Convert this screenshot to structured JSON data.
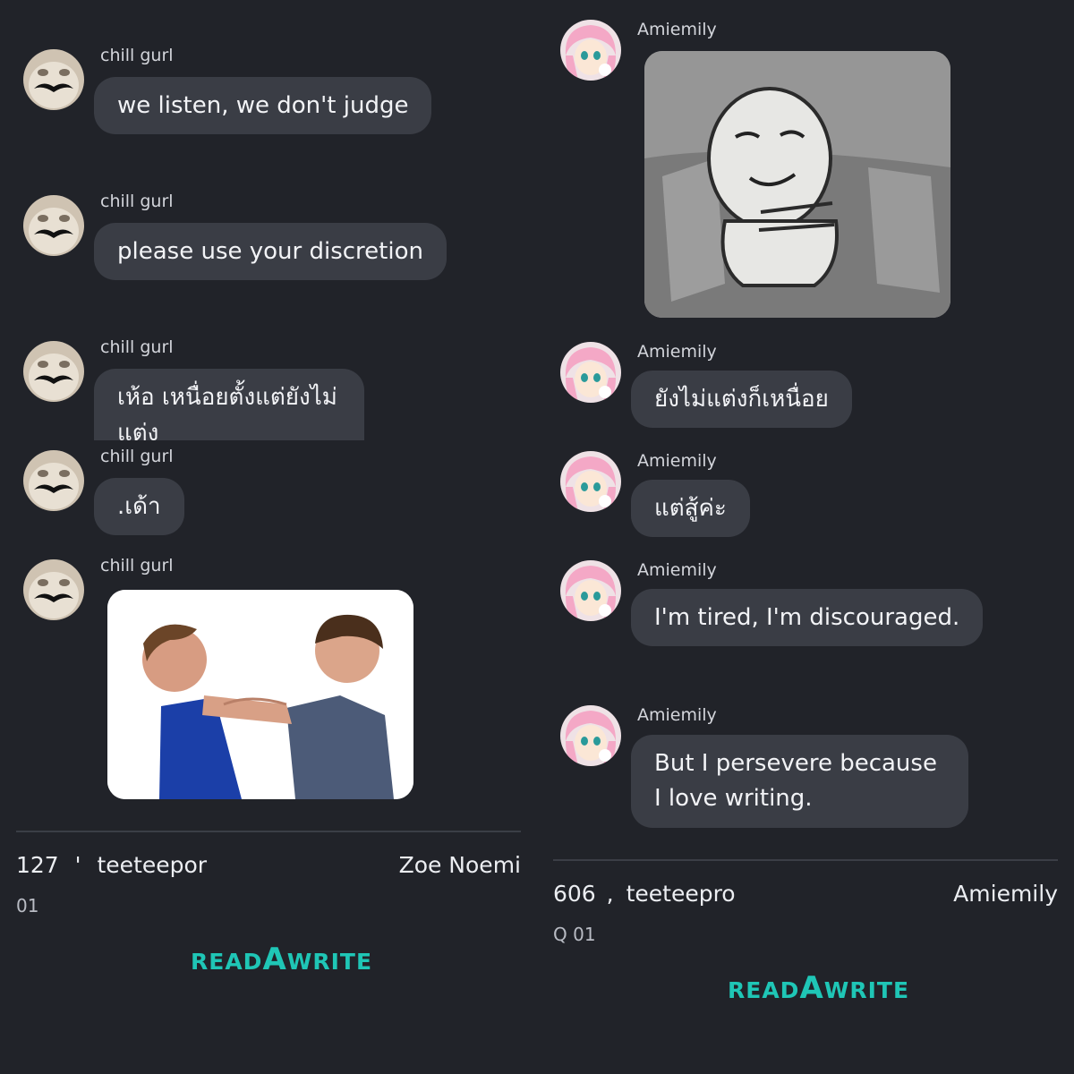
{
  "left": {
    "messages": [
      {
        "sender": "chill gurl",
        "text": "we listen, we don't judge"
      },
      {
        "sender": "chill gurl",
        "text": "please use your discretion"
      },
      {
        "sender": "chill gurl",
        "text": "เห้อ เหนื่อยตั้งแต่ยังไม่แต่ง"
      },
      {
        "sender": "chill gurl",
        "text": ".เด้า"
      },
      {
        "sender": "chill gurl",
        "image": "choking-meme-photo"
      }
    ],
    "footer": {
      "count": "127",
      "separator": "'",
      "user": "teeteepor",
      "author": "Zoe Noemi",
      "sub": "01"
    },
    "brand": {
      "pre": "READ",
      "mid": "A",
      "post": "WRITE"
    }
  },
  "right": {
    "messages": [
      {
        "sender": "Amiemily",
        "image": "crouching-cartoon-sticker"
      },
      {
        "sender": "Amiemily",
        "text": "ยังไม่แต่งก็เหนื่อย"
      },
      {
        "sender": "Amiemily",
        "text": "แต่สู้ค่ะ"
      },
      {
        "sender": "Amiemily",
        "text": "I'm tired, I'm discouraged."
      },
      {
        "sender": "Amiemily",
        "text": "But I persevere because I love writing."
      }
    ],
    "footer": {
      "count": "606",
      "separator": ",",
      "user": "teeteepro",
      "author": "Amiemily",
      "sub": "Q 01"
    },
    "brand": {
      "pre": "READ",
      "mid": "A",
      "post": "WRITE"
    }
  },
  "colors": {
    "background": "#212329",
    "bubble": "#3a3d45",
    "brand": "#1fc6b6",
    "divider": "#3b3e46"
  }
}
